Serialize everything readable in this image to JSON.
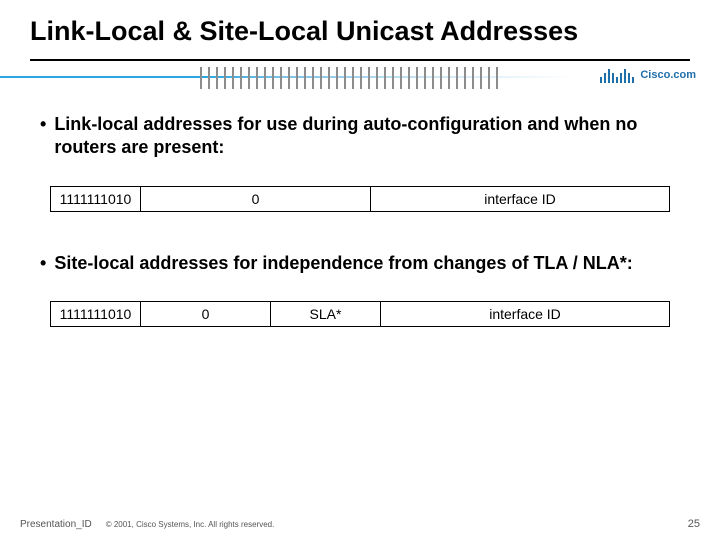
{
  "title": "Link-Local & Site-Local Unicast Addresses",
  "logo_text": "Cisco.com",
  "bullets": [
    "Link-local addresses for use during auto-configuration and when no routers are present:",
    "Site-local addresses for independence from changes of TLA / NLA*:"
  ],
  "table1": {
    "prefix": "1111111010",
    "zero": "0",
    "iface": "interface ID"
  },
  "table2": {
    "prefix": "1111111010",
    "zero": "0",
    "sla": "SLA*",
    "iface": "interface ID"
  },
  "footer": {
    "presentation_id": "Presentation_ID",
    "copyright": "© 2001, Cisco Systems, Inc. All rights reserved.",
    "page": "25"
  }
}
